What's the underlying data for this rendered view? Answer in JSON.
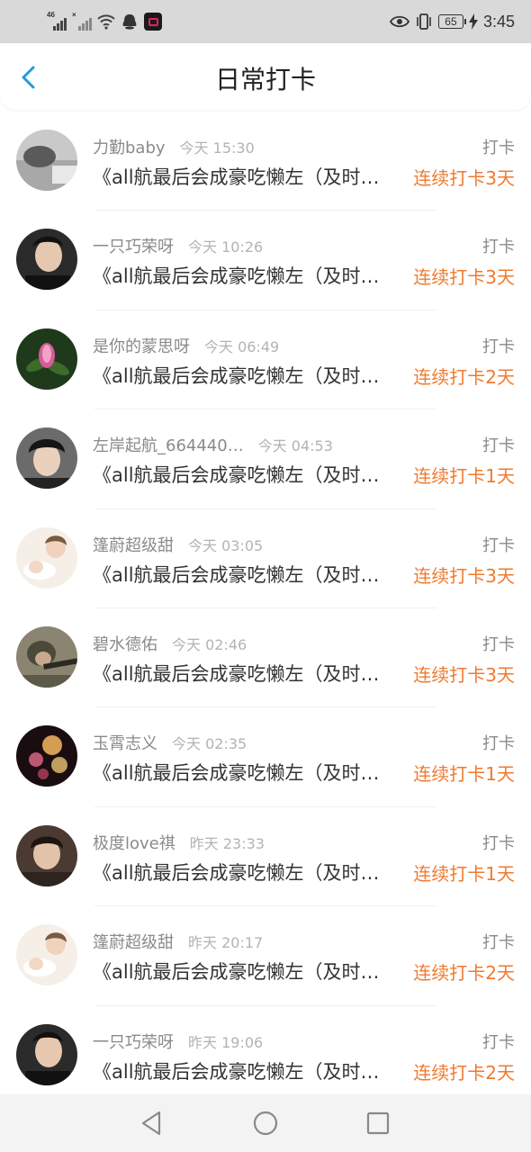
{
  "status_bar": {
    "net_1": "46",
    "net_2": "×",
    "battery": "65",
    "time": "3:45",
    "icons": [
      "signal-icon",
      "signal-icon",
      "wifi-icon",
      "qq-icon",
      "app-icon",
      "eye-icon",
      "vibrate-icon",
      "battery-icon",
      "charging-icon"
    ]
  },
  "header": {
    "title": "日常打卡",
    "back_icon": "chevron-left-icon",
    "accent": "#1e9be0"
  },
  "colors": {
    "streak": "#f07a2f"
  },
  "entries": [
    {
      "user": "力勤baby",
      "time": "今天 15:30",
      "action": "打卡",
      "text": "《all航最后会成豪吃懒左（及时…",
      "streak": "连续打卡3天"
    },
    {
      "user": "一只巧荣呀",
      "time": "今天 10:26",
      "action": "打卡",
      "text": "《all航最后会成豪吃懒左（及时…",
      "streak": "连续打卡3天"
    },
    {
      "user": "是你的蒙思呀",
      "time": "今天 06:49",
      "action": "打卡",
      "text": "《all航最后会成豪吃懒左（及时…",
      "streak": "连续打卡2天"
    },
    {
      "user": "左岸起航_664440…",
      "time": "今天 04:53",
      "action": "打卡",
      "text": "《all航最后会成豪吃懒左（及时…",
      "streak": "连续打卡1天"
    },
    {
      "user": "篷蔚超级甜",
      "time": "今天 03:05",
      "action": "打卡",
      "text": "《all航最后会成豪吃懒左（及时…",
      "streak": "连续打卡3天"
    },
    {
      "user": "碧水德佑",
      "time": "今天 02:46",
      "action": "打卡",
      "text": "《all航最后会成豪吃懒左（及时…",
      "streak": "连续打卡3天"
    },
    {
      "user": "玉霄志义",
      "time": "今天 02:35",
      "action": "打卡",
      "text": "《all航最后会成豪吃懒左（及时…",
      "streak": "连续打卡1天"
    },
    {
      "user": "极度love祺",
      "time": "昨天 23:33",
      "action": "打卡",
      "text": "《all航最后会成豪吃懒左（及时…",
      "streak": "连续打卡1天"
    },
    {
      "user": "篷蔚超级甜",
      "time": "昨天 20:17",
      "action": "打卡",
      "text": "《all航最后会成豪吃懒左（及时…",
      "streak": "连续打卡2天"
    },
    {
      "user": "一只巧荣呀",
      "time": "昨天 19:06",
      "action": "打卡",
      "text": "《all航最后会成豪吃懒左（及时…",
      "streak": "连续打卡2天"
    }
  ],
  "nav": {
    "icons": [
      "back-triangle-icon",
      "home-circle-icon",
      "recents-square-icon"
    ]
  }
}
